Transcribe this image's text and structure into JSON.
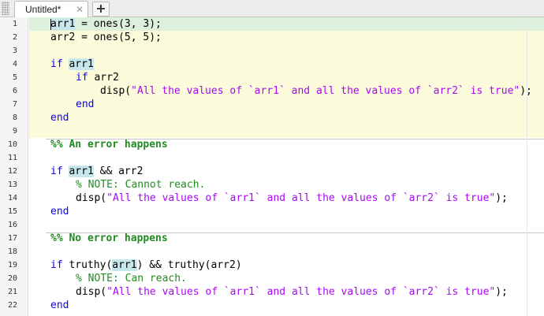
{
  "tab": {
    "title": "Untitled*",
    "close_glyph": "✕",
    "add_glyph": "+"
  },
  "line_numbers": [
    "1",
    "2",
    "3",
    "4",
    "5",
    "6",
    "7",
    "8",
    "9",
    "10",
    "11",
    "12",
    "13",
    "14",
    "15",
    "16",
    "17",
    "18",
    "19",
    "20",
    "21",
    "22"
  ],
  "code": {
    "l1_var": "arr1",
    "l1_rest": " = ones(3, 3);",
    "l2": "arr2 = ones(5, 5);",
    "l4_kw": "if",
    "l4_var": "arr1",
    "l5_kw": "if",
    "l5_rest": " arr2",
    "l6_fn": "disp(",
    "l6_str": "\"All the values of `arr1` and all the values of `arr2` is true\"",
    "l6_end": ");",
    "l7_kw": "end",
    "l8_kw": "end",
    "l10_sec": "%% An error happens",
    "l12_kw": "if",
    "l12_var": "arr1",
    "l12_rest": " && arr2",
    "l13_cmt": "% NOTE: Cannot reach.",
    "l14_fn": "disp(",
    "l14_str": "\"All the values of `arr1` and all the values of `arr2` is true\"",
    "l14_end": ");",
    "l15_kw": "end",
    "l17_sec": "%% No error happens",
    "l19_kw": "if",
    "l19_pre": " truthy(",
    "l19_var": "arr1",
    "l19_rest": ") && truthy(arr2)",
    "l20_cmt": "% NOTE: Can reach.",
    "l21_fn": "disp(",
    "l21_str": "\"All the values of `arr1` and all the values of `arr2` is true\"",
    "l21_end": ");",
    "l22_kw": "end"
  },
  "colors": {
    "keyword": "#0e00ff",
    "string": "#a709f5",
    "comment": "#228b22",
    "current_line": "#dcf0dc",
    "current_cell": "#fbfbdc",
    "variable_highlight": "#c6e8ec"
  }
}
